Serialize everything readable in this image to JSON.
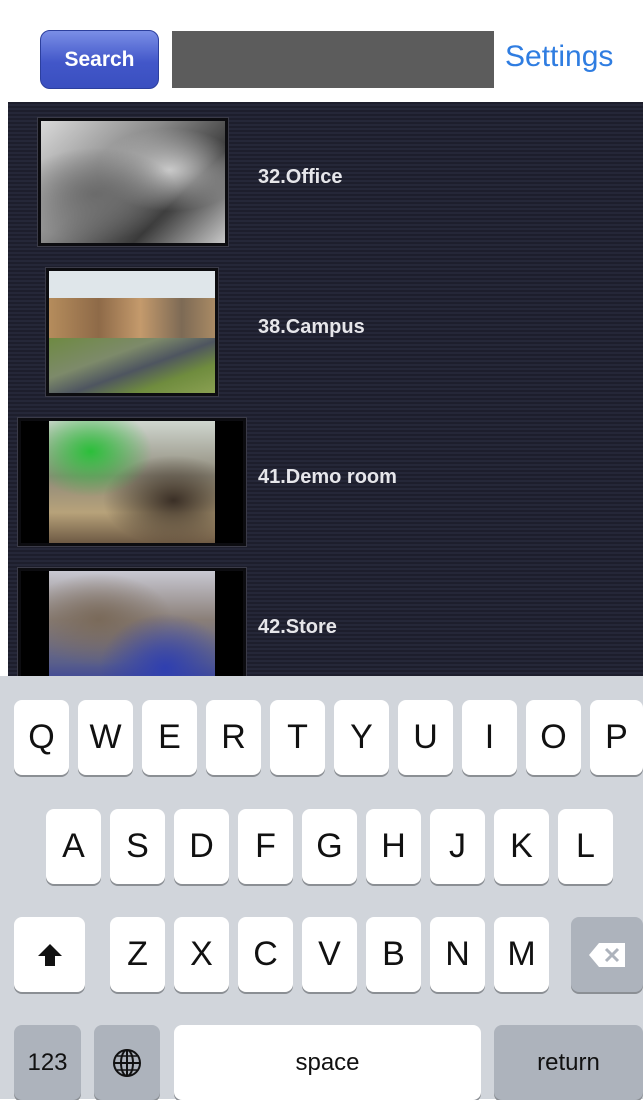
{
  "header": {
    "search_button": "Search",
    "search_value": "",
    "settings_label": "Settings"
  },
  "cameras": [
    {
      "label": "32.Office"
    },
    {
      "label": "38.Campus"
    },
    {
      "label": "41.Demo room"
    },
    {
      "label": "42.Store"
    }
  ],
  "keyboard": {
    "row1": [
      "Q",
      "W",
      "E",
      "R",
      "T",
      "Y",
      "U",
      "I",
      "O",
      "P"
    ],
    "row2": [
      "A",
      "S",
      "D",
      "F",
      "G",
      "H",
      "J",
      "K",
      "L"
    ],
    "row3": [
      "Z",
      "X",
      "C",
      "V",
      "B",
      "N",
      "M"
    ],
    "numbers_key": "123",
    "space_key": "space",
    "return_key": "return",
    "icons": [
      "shift-icon",
      "delete-icon",
      "globe-icon"
    ]
  }
}
